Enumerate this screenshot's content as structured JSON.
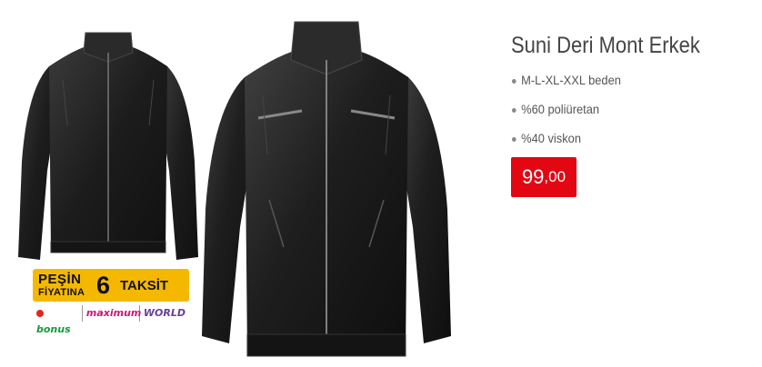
{
  "product": {
    "title": "Suni Deri Mont Erkek",
    "features": [
      "M-L-XL-XXL beden",
      "%60 poliüretan",
      "%40 viskon"
    ],
    "price": {
      "integer": "99",
      "decimal": ",00"
    }
  },
  "promo": {
    "line1": "PEŞİN",
    "line2": "FİYATINA",
    "installment_count": "6",
    "installment_label": "TAKSİT",
    "cards": {
      "bonus": "bonus",
      "maximum": "maximum",
      "world": "WORLD"
    },
    "colors": {
      "badge": "#f5b800",
      "bonus": "#169a3a",
      "maximum": "#d0137a",
      "world": "#6a3d98"
    }
  },
  "images": {
    "small": "jacket-front-small",
    "large": "jacket-front-large"
  },
  "colors": {
    "price_bg": "#e30613",
    "title": "#444444"
  }
}
